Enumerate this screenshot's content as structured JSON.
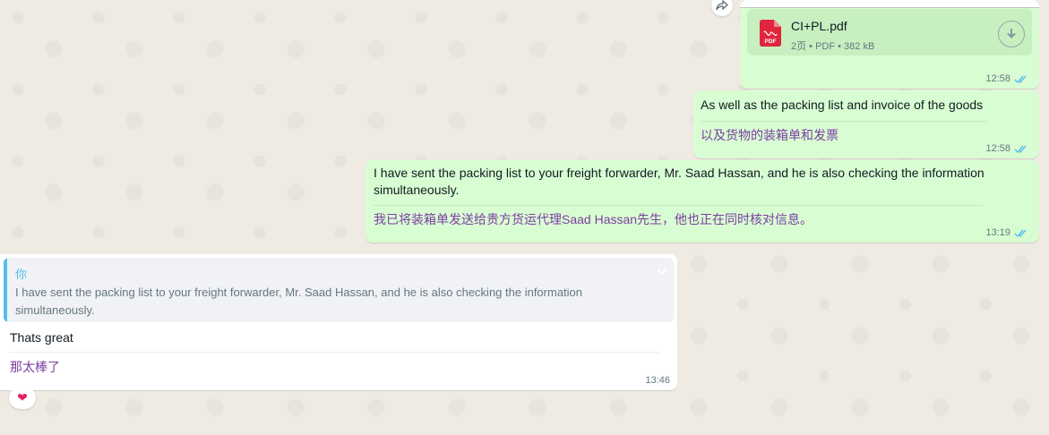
{
  "doc_message": {
    "file_name": "CI+PL.pdf",
    "file_meta": "2页 • PDF • 382 kB",
    "pdf_badge": "PDF",
    "time": "12:58"
  },
  "msg_packing_invoice": {
    "text_en": "As well as the packing list and invoice of the goods",
    "text_cn": "以及货物的装箱单和发票",
    "time": "12:58"
  },
  "msg_sent_freight": {
    "text_en": "I have sent the packing list to your freight forwarder, Mr. Saad Hassan, and he is also checking the information simultaneously.",
    "text_cn": "我已将装箱单发送给贵方货运代理Saad Hassan先生，他也正在同时核对信息。",
    "time": "13:19"
  },
  "msg_reply": {
    "quote_author": "你",
    "quote_text": "I have sent the packing list to your freight forwarder, Mr. Saad Hassan, and he is also checking the information simultaneously.",
    "text_en": "Thats great",
    "text_cn": "那太棒了",
    "time": "13:46",
    "reaction": "❤"
  },
  "colors": {
    "outgoing_bubble": "#d9fdd3",
    "incoming_bubble": "#ffffff",
    "read_ticks": "#53bdeb",
    "translation_text": "#7b3fa0",
    "pdf_red": "#e0263c"
  },
  "icons": [
    "forward-icon",
    "pdf-icon",
    "download-icon",
    "read-ticks-icon",
    "chevron-down-icon",
    "heart-reaction-icon"
  ]
}
